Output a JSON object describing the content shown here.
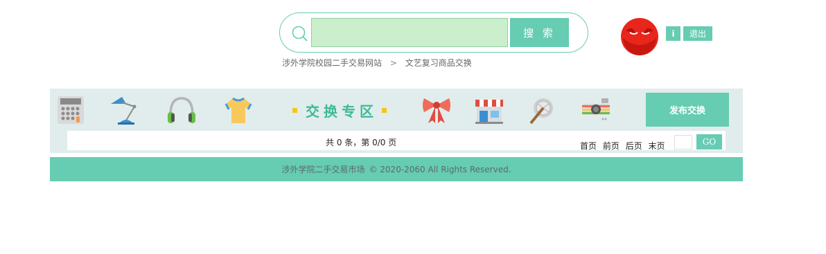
{
  "search": {
    "placeholder": "",
    "value": "",
    "button_label": "搜 索"
  },
  "breadcrumb": {
    "home": "涉外学院校园二手交易网站",
    "separator": ">",
    "current": "文艺复习商品交换"
  },
  "user": {
    "info_label": "i",
    "logout_label": "退出"
  },
  "categories": {
    "icons": [
      "calculator-icon",
      "desk-lamp-icon",
      "headphones-icon",
      "tshirt-icon",
      "bow-icon",
      "shop-icon",
      "badminton-icon",
      "camera-icon"
    ],
    "zone_title": "交换专区",
    "publish_label": "发布交换"
  },
  "pagination": {
    "summary": "共 0 条，第 0/0 页",
    "first": "首页",
    "prev": "前页",
    "next": "后页",
    "last": "末页",
    "page_input_value": "",
    "go_label": "GO"
  },
  "footer": {
    "site_name": "涉外学院二手交易市场",
    "copyright": "© 2020-2060 All Rights Reserved."
  },
  "colors": {
    "accent": "#66ccb2",
    "search_field": "#cbeecd",
    "category_bar": "#e0edec",
    "zone_title": "#3eb996",
    "avatar": "#e8261c"
  }
}
